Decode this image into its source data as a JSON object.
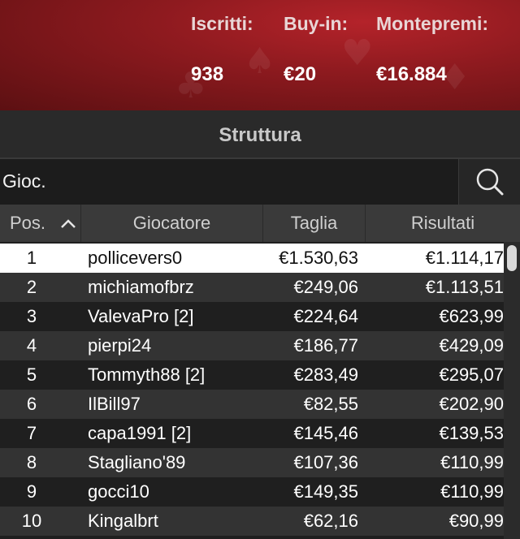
{
  "tournament": {
    "stats": [
      {
        "label": "Iscritti:",
        "value": "938"
      },
      {
        "label": "Buy-in:",
        "value": "€20"
      },
      {
        "label": "Montepremi:",
        "value": "€16.884"
      }
    ]
  },
  "section_title": "Struttura",
  "search": {
    "value": "Gioc.",
    "icon": "search-icon"
  },
  "table": {
    "columns": [
      "Pos.",
      "Giocatore",
      "Taglia",
      "Risultati"
    ],
    "sort_icon": "chevron-up-icon",
    "rows": [
      {
        "pos": "1",
        "player": "pollicevers0",
        "taglia": "€1.530,63",
        "risultati": "€1.114,17"
      },
      {
        "pos": "2",
        "player": "michiamofbrz",
        "taglia": "€249,06",
        "risultati": "€1.113,51"
      },
      {
        "pos": "3",
        "player": "ValevaPro [2]",
        "taglia": "€224,64",
        "risultati": "€623,99"
      },
      {
        "pos": "4",
        "player": "pierpi24",
        "taglia": "€186,77",
        "risultati": "€429,09"
      },
      {
        "pos": "5",
        "player": "Tommyth88 [2]",
        "taglia": "€283,49",
        "risultati": "€295,07"
      },
      {
        "pos": "6",
        "player": "IlBill97",
        "taglia": "€82,55",
        "risultati": "€202,90"
      },
      {
        "pos": "7",
        "player": "capa1991 [2]",
        "taglia": "€145,46",
        "risultati": "€139,53"
      },
      {
        "pos": "8",
        "player": "Stagliano'89",
        "taglia": "€107,36",
        "risultati": "€110,99"
      },
      {
        "pos": "9",
        "player": "gocci10",
        "taglia": "€149,35",
        "risultati": "€110,99"
      },
      {
        "pos": "10",
        "player": "Kingalbrt",
        "taglia": "€62,16",
        "risultati": "€90,99"
      }
    ]
  }
}
